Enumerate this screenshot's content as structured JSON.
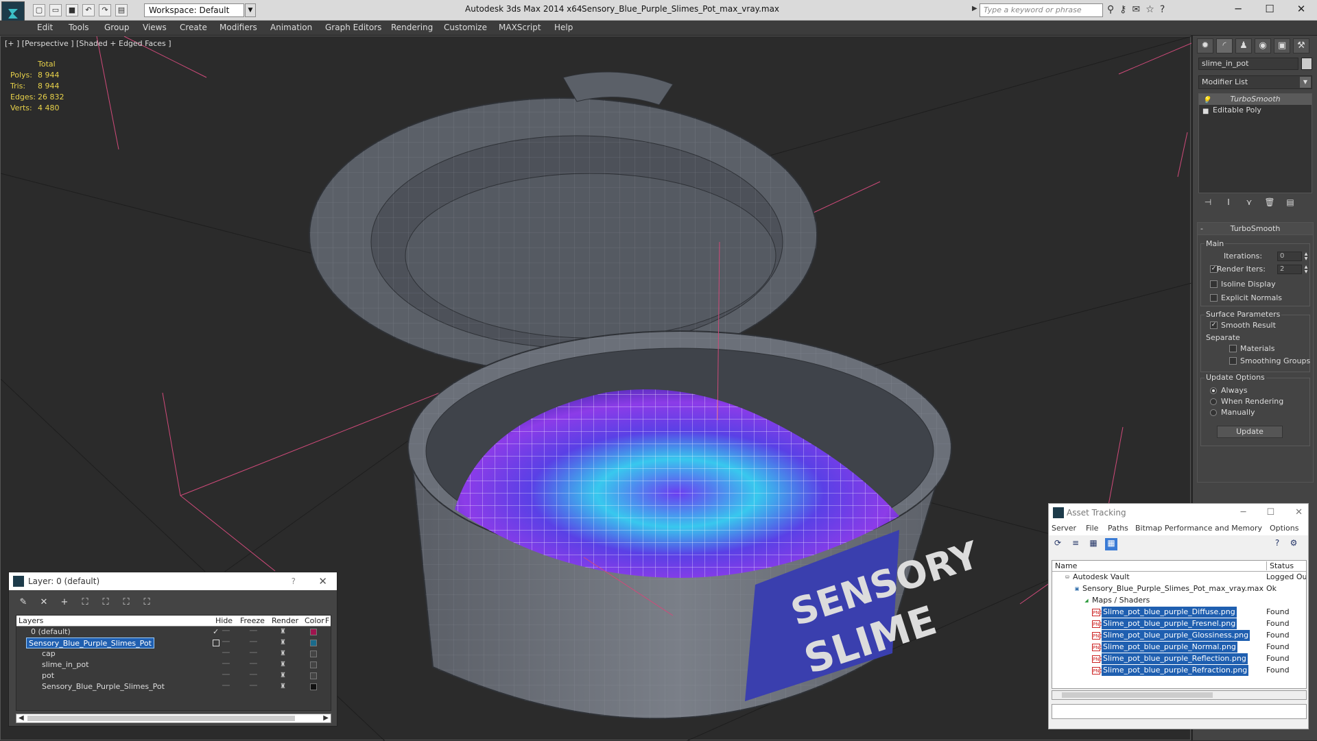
{
  "titlebar": {
    "workspace": "Workspace: Default",
    "app_title": "Autodesk 3ds Max  2014 x64",
    "doc_title": "Sensory_Blue_Purple_Slimes_Pot_max_vray.max",
    "search_placeholder": "Type a keyword or phrase"
  },
  "menu": [
    "Edit",
    "Tools",
    "Group",
    "Views",
    "Create",
    "Modifiers",
    "Animation",
    "Graph Editors",
    "Rendering",
    "Customize",
    "MAXScript",
    "Help"
  ],
  "viewport": {
    "label": "[+ ] [Perspective ] [Shaded + Edged Faces ]",
    "stats_header": "Total",
    "stats": [
      {
        "k": "Polys:",
        "v": "8 944"
      },
      {
        "k": "Tris:",
        "v": "8 944"
      },
      {
        "k": "Edges:",
        "v": "26 832"
      },
      {
        "k": "Verts:",
        "v": "4 480"
      }
    ]
  },
  "command_panel": {
    "object_name": "slime_in_pot",
    "modifier_list": "Modifier List",
    "stack": [
      "TurboSmooth",
      "Editable Poly"
    ],
    "rollout_title": "TurboSmooth",
    "main_label": "Main",
    "iterations_label": "Iterations:",
    "iterations_value": "0",
    "render_iters_label": "Render Iters:",
    "render_iters_value": "2",
    "isoline": "Isoline Display",
    "explicit_normals": "Explicit Normals",
    "surface_params": "Surface Parameters",
    "smooth_result": "Smooth Result",
    "separate": "Separate",
    "materials": "Materials",
    "smoothing_groups": "Smoothing Groups",
    "update_options": "Update Options",
    "always": "Always",
    "when_rendering": "When Rendering",
    "manually": "Manually",
    "update_button": "Update"
  },
  "layer_window": {
    "title": "Layer: 0 (default)",
    "help": "?",
    "columns": {
      "layers": "Layers",
      "hide": "Hide",
      "freeze": "Freeze",
      "render": "Render",
      "color": "Color",
      "f": "F"
    },
    "rows": [
      {
        "name": "0 (default)",
        "indent": 0,
        "color": "#a0144e"
      },
      {
        "name": "Sensory_Blue_Purple_Slimes_Pot",
        "indent": 0,
        "color": "#1a6b8c"
      },
      {
        "name": "cap",
        "indent": 1,
        "color": "#444444"
      },
      {
        "name": "slime_in_pot",
        "indent": 1,
        "color": "#444444"
      },
      {
        "name": "pot",
        "indent": 1,
        "color": "#444444"
      },
      {
        "name": "Sensory_Blue_Purple_Slimes_Pot",
        "indent": 1,
        "color": "#111111"
      }
    ]
  },
  "asset_window": {
    "title": "Asset Tracking",
    "menu": [
      "Server",
      "File",
      "Paths",
      "Bitmap Performance and Memory",
      "Options"
    ],
    "col_name": "Name",
    "col_status": "Status",
    "rows": [
      {
        "name": "Autodesk Vault",
        "status": "Logged Ou",
        "indent": 0
      },
      {
        "name": "Sensory_Blue_Purple_Slimes_Pot_max_vray.max",
        "status": "Ok",
        "indent": 1
      },
      {
        "name": "Maps / Shaders",
        "status": "",
        "indent": 2
      },
      {
        "name": "Slime_pot_blue_purple_Diffuse.png",
        "status": "Found",
        "indent": 3
      },
      {
        "name": "Slime_pot_blue_purple_Fresnel.png",
        "status": "Found",
        "indent": 3
      },
      {
        "name": "Slime_pot_blue_purple_Glossiness.png",
        "status": "Found",
        "indent": 3
      },
      {
        "name": "Slime_pot_blue_purple_Normal.png",
        "status": "Found",
        "indent": 3
      },
      {
        "name": "Slime_pot_blue_purple_Reflection.png",
        "status": "Found",
        "indent": 3
      },
      {
        "name": "Slime_pot_blue_purple_Refraction.png",
        "status": "Found",
        "indent": 3
      }
    ]
  }
}
